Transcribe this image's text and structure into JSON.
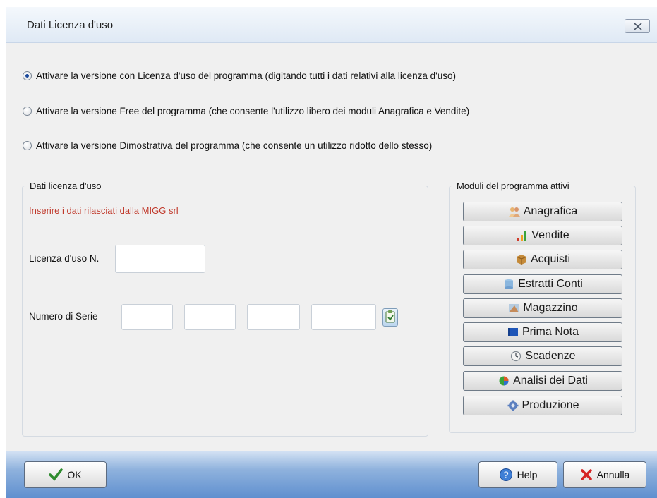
{
  "window": {
    "title": "Dati Licenza d'uso",
    "close_icon": "close-icon"
  },
  "options": [
    {
      "label": "Attivare la versione con Licenza d'uso del programma (digitando tutti i dati relativi alla licenza d'uso)",
      "selected": true
    },
    {
      "label": "Attivare la versione Free del programma (che consente l'utilizzo libero dei moduli Anagrafica e Vendite)",
      "selected": false
    },
    {
      "label": "Attivare la versione Dimostrativa del programma (che consente un utilizzo ridotto dello stesso)",
      "selected": false
    }
  ],
  "license": {
    "group_title": "Dati licenza d'uso",
    "note": "Inserire i dati rilasciati dalla MIGG srl",
    "license_label": "Licenza d'uso N.",
    "license_value": "",
    "serial_label": "Numero di Serie",
    "serial_values": [
      "",
      "",
      "",
      ""
    ],
    "accent_color": "#c0392b"
  },
  "modules": {
    "group_title": "Moduli del programma attivi",
    "items": [
      {
        "label": "Anagrafica",
        "icon": "people-icon"
      },
      {
        "label": "Vendite",
        "icon": "bar-chart-icon"
      },
      {
        "label": "Acquisti",
        "icon": "box-icon"
      },
      {
        "label": "Estratti Conti",
        "icon": "database-icon"
      },
      {
        "label": "Magazzino",
        "icon": "warehouse-icon"
      },
      {
        "label": "Prima Nota",
        "icon": "book-icon"
      },
      {
        "label": "Scadenze",
        "icon": "clock-icon"
      },
      {
        "label": "Analisi dei Dati",
        "icon": "pie-chart-icon"
      },
      {
        "label": "Produzione",
        "icon": "gear-icon"
      }
    ]
  },
  "footer": {
    "ok_label": "OK",
    "help_label": "Help",
    "cancel_label": "Annulla"
  }
}
